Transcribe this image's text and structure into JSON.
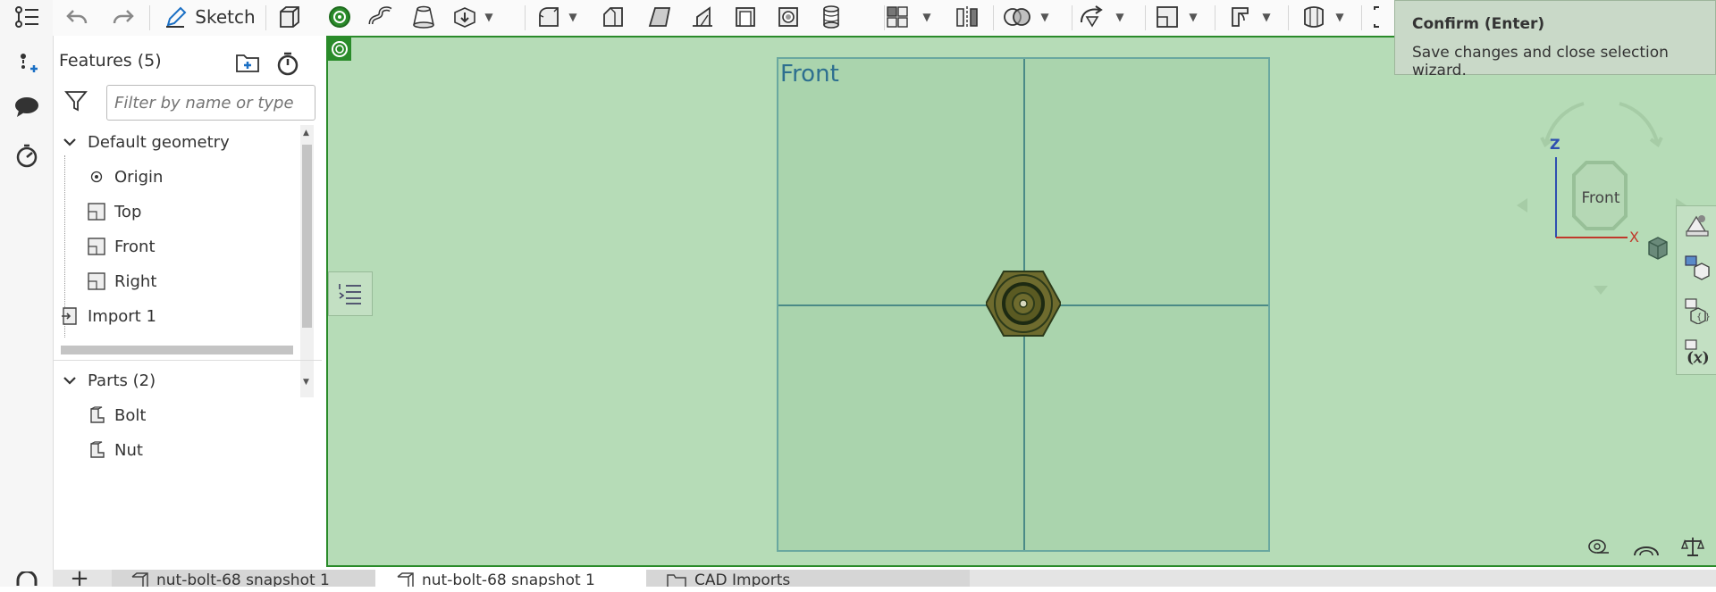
{
  "toolbar": {
    "sketch_label": "Sketch"
  },
  "features": {
    "header": "Features (5)",
    "filter_placeholder": "Filter by name or type",
    "default_geometry": "Default geometry",
    "items": [
      {
        "label": "Origin"
      },
      {
        "label": "Top"
      },
      {
        "label": "Front"
      },
      {
        "label": "Right"
      }
    ],
    "import_label": "Import 1"
  },
  "parts": {
    "header": "Parts (2)",
    "items": [
      {
        "label": "Bolt"
      },
      {
        "label": "Nut"
      }
    ]
  },
  "viewport": {
    "plane_label": "Front",
    "view_cube_label": "Front",
    "axis_z": "Z",
    "axis_x": "X"
  },
  "tooltip": {
    "title": "Confirm (Enter)",
    "body": "Save changes and close selection wizard."
  },
  "tabs": [
    {
      "label": "nut-bolt-68 snapshot 1"
    },
    {
      "label": "nut-bolt-68 snapshot 1"
    },
    {
      "label": "CAD Imports"
    }
  ],
  "colors": {
    "viewport_bg": "#b6dcb7",
    "viewport_border": "#2a8b2a",
    "part_color": "#6e6b2e",
    "plane_line": "#4a8a86"
  }
}
